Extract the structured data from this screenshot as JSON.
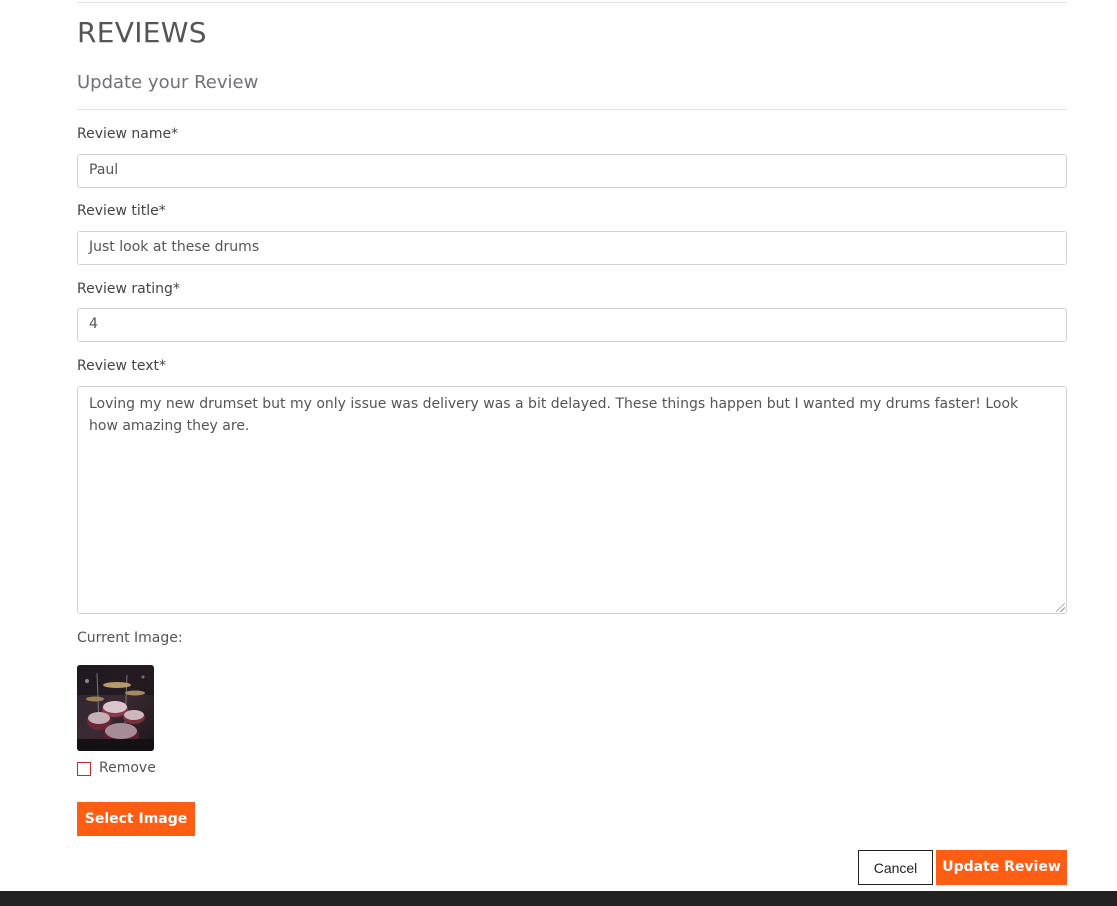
{
  "page": {
    "title": "REVIEWS",
    "subtitle": "Update your Review"
  },
  "form": {
    "name": {
      "label": "Review name*",
      "value": "Paul"
    },
    "title": {
      "label": "Review title*",
      "value": "Just look at these drums"
    },
    "rating": {
      "label": "Review rating*",
      "value": "4"
    },
    "text": {
      "label": "Review text*",
      "value": "Loving my new drumset but my only issue was delivery was a bit delayed. These things happen but I wanted my drums faster! Look how amazing they are."
    },
    "image": {
      "label": "Current Image:",
      "thumbnail_icon": "drum-kit-photo",
      "remove_label": "Remove",
      "remove_checked": false,
      "select_button": "Select Image"
    }
  },
  "actions": {
    "cancel": "Cancel",
    "submit": "Update Review"
  },
  "colors": {
    "accent": "#fe5d14",
    "footer": "#222222",
    "checkbox_border": "#c62828"
  }
}
